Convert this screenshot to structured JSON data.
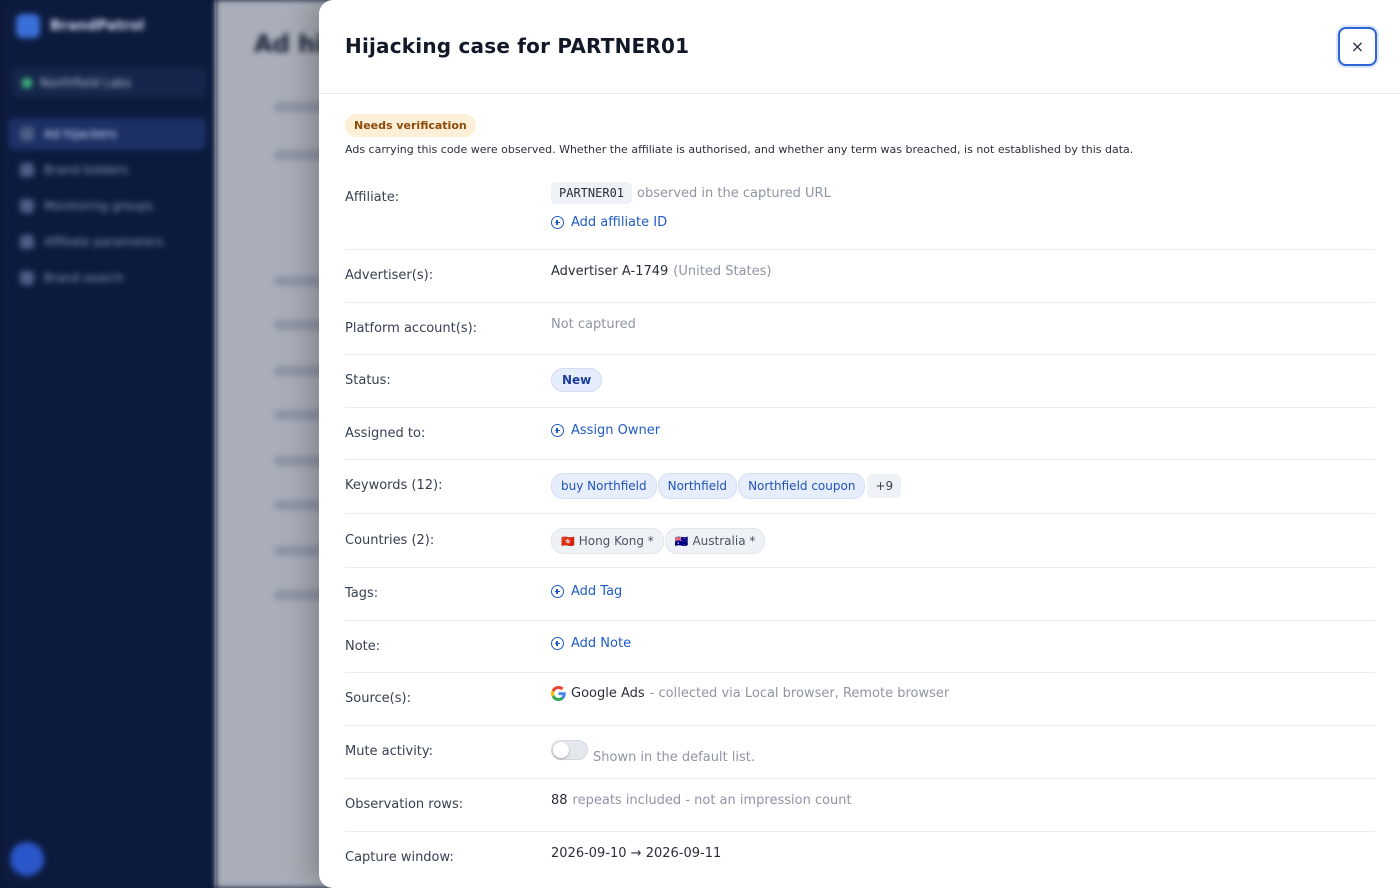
{
  "background": {
    "brand": "BrandPatrol",
    "workspace": "Northfield Labs",
    "nav": [
      "Ad hijackers",
      "Brand bidders",
      "Monitoring groups",
      "Affiliate parameters",
      "Brand search"
    ],
    "page_title": "Ad hij"
  },
  "panel": {
    "title": "Hijacking case for PARTNER01",
    "close_label": "×",
    "verification_badge": "Needs verification",
    "verification_note": "Ads carrying this code were observed. Whether the affiliate is authorised, and whether any term was breached, is not established by this data."
  },
  "fields": {
    "affiliate": {
      "label": "Affiliate:",
      "code": "PARTNER01",
      "code_note": "observed in the captured URL",
      "add_label": "Add affiliate ID"
    },
    "advertisers": {
      "label": "Advertiser(s):",
      "name": "Advertiser A-1749",
      "country": "(United States)"
    },
    "platform_accounts": {
      "label": "Platform account(s):",
      "value": "Not captured"
    },
    "status": {
      "label": "Status:",
      "value": "New"
    },
    "assigned_to": {
      "label": "Assigned to:",
      "add_label": "Assign Owner"
    },
    "keywords": {
      "label": "Keywords (12):",
      "items": [
        "buy Northfield",
        "Northfield",
        "Northfield coupon"
      ],
      "more": "+9"
    },
    "countries": {
      "label": "Countries (2):",
      "items": [
        {
          "flag": "🇭🇰",
          "name": "Hong Kong *"
        },
        {
          "flag": "🇦🇺",
          "name": "Australia *"
        }
      ]
    },
    "tags": {
      "label": "Tags:",
      "add_label": "Add Tag"
    },
    "note": {
      "label": "Note:",
      "add_label": "Add Note"
    },
    "sources": {
      "label": "Source(s):",
      "name": "Google Ads",
      "detail": "- collected via Local browser, Remote browser"
    },
    "mute_activity": {
      "label": "Mute activity:",
      "enabled": false,
      "hint": "Shown in the default list."
    },
    "observation_rows": {
      "label": "Observation rows:",
      "count": "88",
      "hint": "repeats included - not an impression count"
    },
    "capture_window": {
      "label": "Capture window:",
      "value": "2026-09-10 → 2026-09-11"
    }
  },
  "colors": {
    "accent": "#1f5bc4",
    "badge_warning_bg": "#fdeed8",
    "badge_warning_text": "#8b4a08",
    "sidebar": "#0c1a3d"
  }
}
